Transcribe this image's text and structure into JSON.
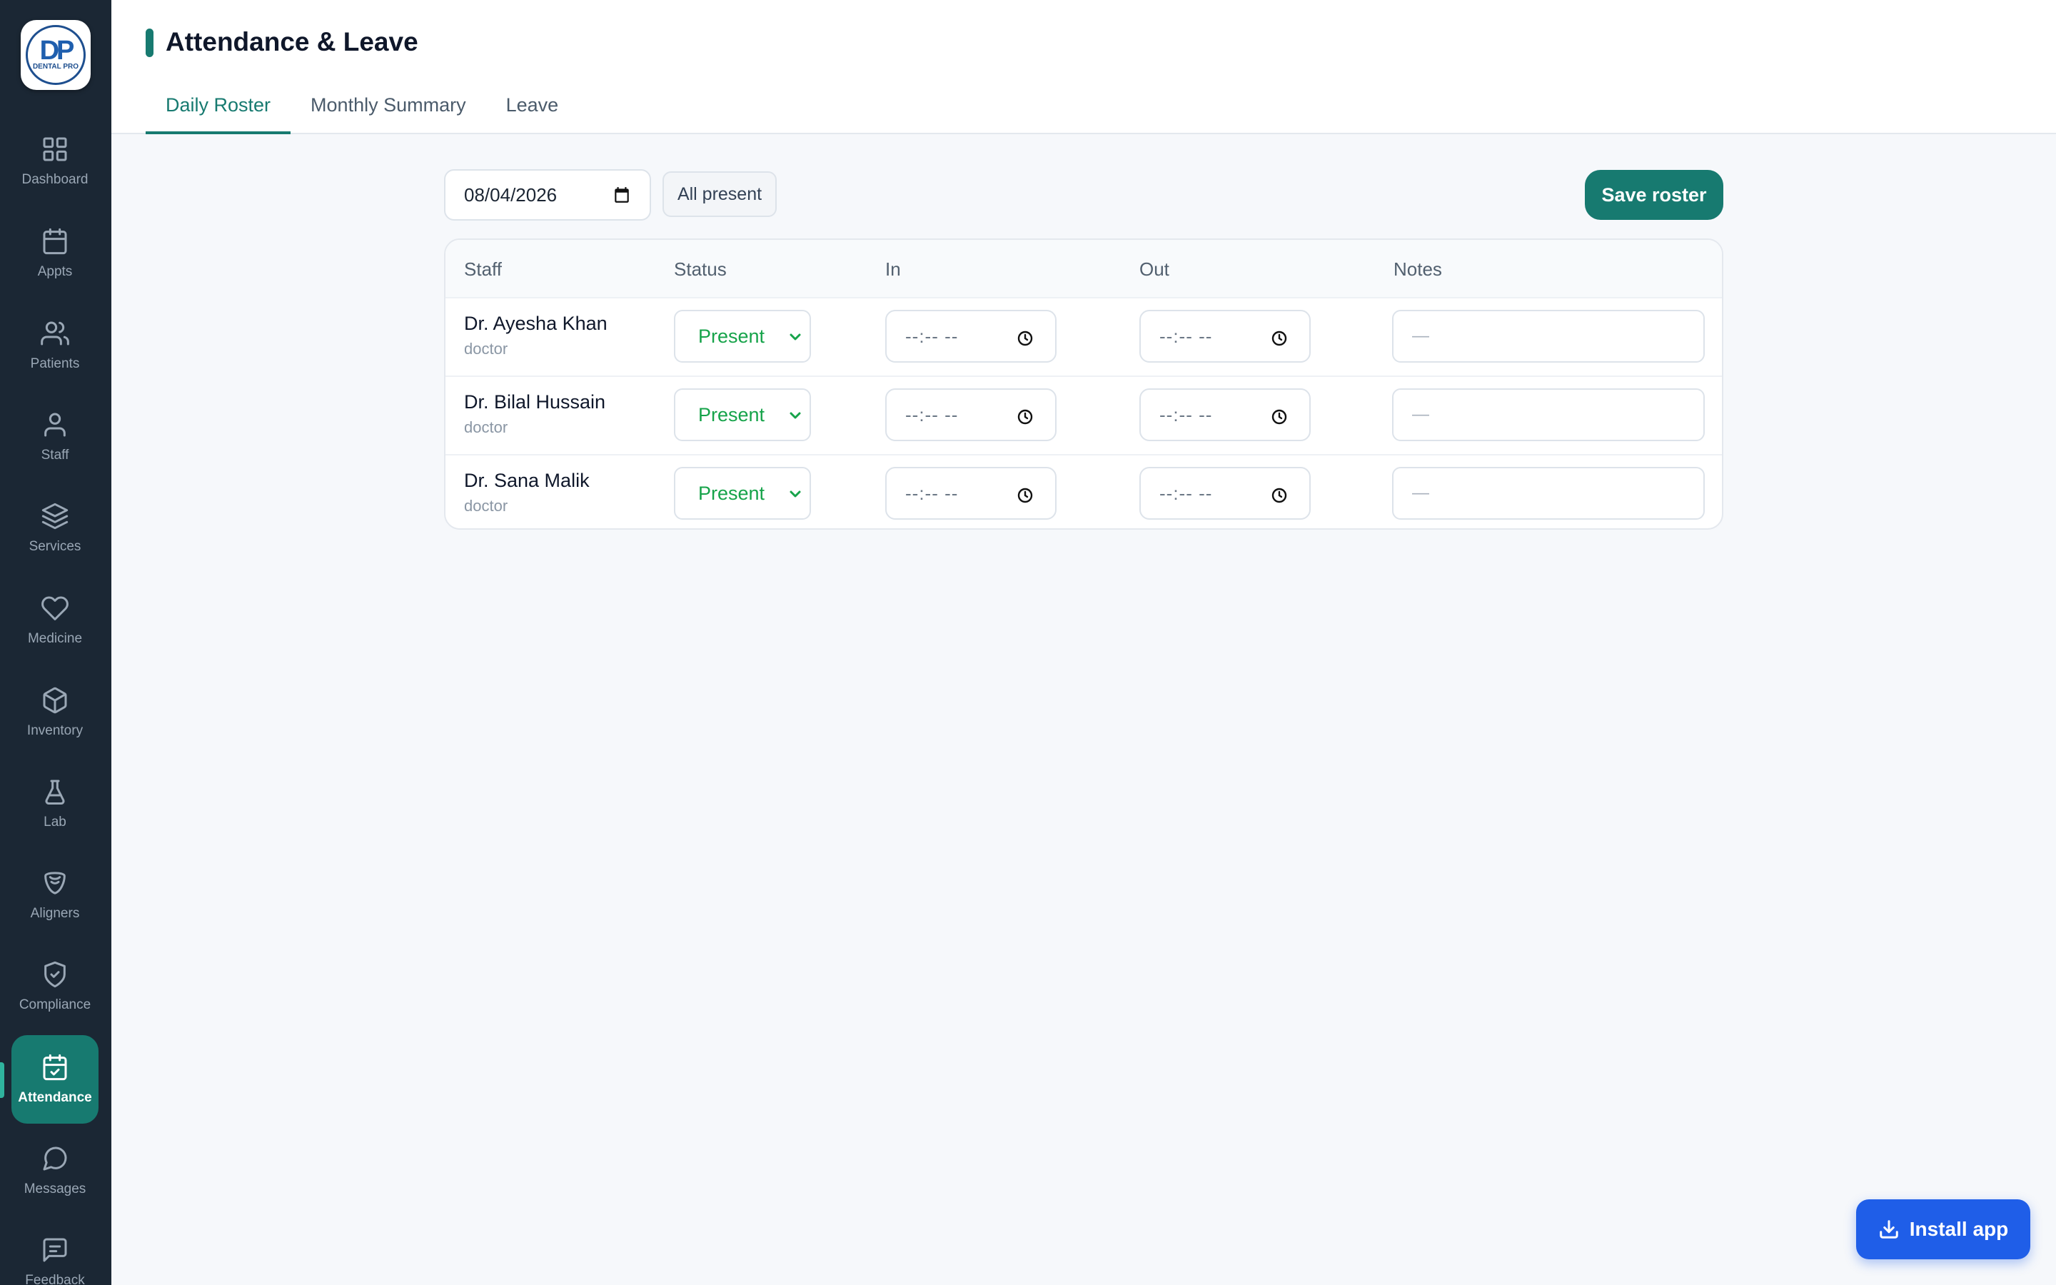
{
  "brand": {
    "mark": "DP",
    "name": "DENTAL PRO"
  },
  "sidebar": {
    "items": [
      {
        "label": "Dashboard",
        "icon": "grid-icon"
      },
      {
        "label": "Appts",
        "icon": "calendar-icon"
      },
      {
        "label": "Patients",
        "icon": "users-icon"
      },
      {
        "label": "Staff",
        "icon": "user-icon"
      },
      {
        "label": "Services",
        "icon": "layers-icon"
      },
      {
        "label": "Medicine",
        "icon": "heart-icon"
      },
      {
        "label": "Inventory",
        "icon": "box-icon"
      },
      {
        "label": "Lab",
        "icon": "flask-icon"
      },
      {
        "label": "Aligners",
        "icon": "aligner-icon"
      },
      {
        "label": "Compliance",
        "icon": "shield-check-icon"
      },
      {
        "label": "Attendance",
        "icon": "calendar-check-icon",
        "active": true
      },
      {
        "label": "Messages",
        "icon": "message-circle-icon"
      },
      {
        "label": "Feedback",
        "icon": "message-square-icon"
      }
    ]
  },
  "header": {
    "title": "Attendance & Leave",
    "tabs": [
      {
        "label": "Daily Roster",
        "active": true
      },
      {
        "label": "Monthly Summary"
      },
      {
        "label": "Leave"
      }
    ]
  },
  "toolbar": {
    "date": "08/04/2026",
    "all_present_label": "All present",
    "save_label": "Save roster"
  },
  "table": {
    "columns": [
      "Staff",
      "Status",
      "In",
      "Out",
      "Notes"
    ],
    "rows": [
      {
        "name": "Dr. Ayesha Khan",
        "role": "doctor",
        "status": "Present",
        "in": "--:-- --",
        "out": "--:-- --",
        "notes_placeholder": "—"
      },
      {
        "name": "Dr. Bilal Hussain",
        "role": "doctor",
        "status": "Present",
        "in": "--:-- --",
        "out": "--:-- --",
        "notes_placeholder": "—"
      },
      {
        "name": "Dr. Sana Malik",
        "role": "doctor",
        "status": "Present",
        "in": "--:-- --",
        "out": "--:-- --",
        "notes_placeholder": "—"
      }
    ]
  },
  "install_app_label": "Install app",
  "colors": {
    "sidebar_bg": "#1b2734",
    "accent": "#177a70",
    "present": "#16a34a",
    "install_button": "#1f5ee8"
  }
}
